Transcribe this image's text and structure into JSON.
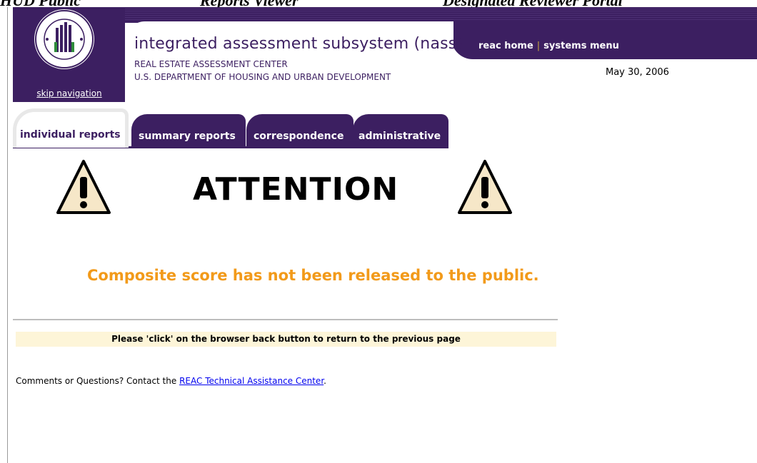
{
  "caption": {
    "part1": "HUD Public",
    "part2": "Reports Viewer",
    "part3": "Designated Reviewer Portal"
  },
  "header": {
    "skip_nav": "skip navigation",
    "app_title": "integrated assessment subsystem (nass)",
    "org_line1": "REAL ESTATE ASSESSMENT CENTER",
    "org_line2": "U.S. DEPARTMENT OF HOUSING AND URBAN DEVELOPMENT",
    "links": {
      "home": "reac home",
      "menu": "systems menu"
    },
    "date": "May 30, 2006"
  },
  "tabs": [
    {
      "label": "individual reports",
      "active": true
    },
    {
      "label": "summary reports",
      "active": false
    },
    {
      "label": "correspondence",
      "active": false
    },
    {
      "label": "administrative",
      "active": false
    }
  ],
  "main": {
    "attention": "ATTENTION",
    "message": "Composite score has not been released to the public.",
    "back_instruction": "Please 'click' on the browser back button to return to the previous page",
    "comments_prefix": "Comments or Questions? Contact the ",
    "comments_link": "REAC Technical Assistance Center",
    "comments_suffix": "."
  },
  "colors": {
    "brand": "#3c1f61",
    "accent": "#f29a1a",
    "notice_bg": "#fdf5d8"
  },
  "icons": [
    "hud-seal-icon",
    "warning-triangle-icon"
  ]
}
